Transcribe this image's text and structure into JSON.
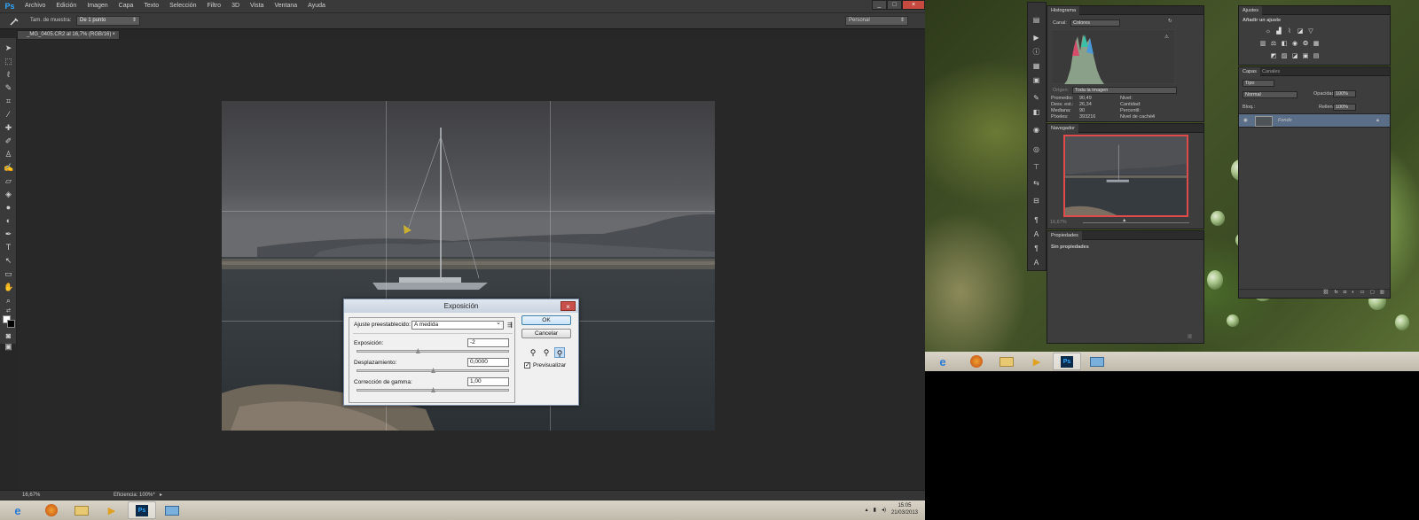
{
  "photoshop": {
    "logo": "Ps",
    "menu": [
      "Archivo",
      "Edición",
      "Imagen",
      "Capa",
      "Texto",
      "Selección",
      "Filtro",
      "3D",
      "Vista",
      "Ventana",
      "Ayuda"
    ],
    "window_buttons": [
      "_",
      "□",
      "×"
    ],
    "options_bar": {
      "sample_size_label": "Tam. de muestra:",
      "sample_size_value": "De 1 punto",
      "workspace_value": "Personal"
    },
    "document_tab": {
      "title": "_MG_0405.CR2 al 16,7% (RGB/16)",
      "close": "×"
    },
    "status_bar": {
      "zoom": "16,67%",
      "info": "Eficiencia: 100%*",
      "arrow": "▸"
    }
  },
  "exposure_dialog": {
    "title": "Exposición",
    "close": "×",
    "preset_label": "Ajuste preestablecido:",
    "preset_value": "A medida",
    "exposure_label": "Exposición:",
    "exposure_value": "-2",
    "exposure_slider_fraction": 0.4,
    "offset_label": "Desplazamiento:",
    "offset_value": "0,0000",
    "offset_slider_fraction": 0.5,
    "gamma_label": "Corrección de gamma:",
    "gamma_value": "1,00",
    "gamma_slider_fraction": 0.5,
    "ok_label": "OK",
    "cancel_label": "Cancelar",
    "preview_label": "Previsualizar",
    "preview_checked": true
  },
  "histogram_panel": {
    "tab": "Histograma",
    "channel_label": "Canal:",
    "channel_value": "Colores",
    "origin_label": "Origen:",
    "origin_value": "Toda la imagen",
    "stats_left": [
      {
        "label": "Promedio:",
        "value": "90,49"
      },
      {
        "label": "Desv. est.:",
        "value": "26,34"
      },
      {
        "label": "Mediana:",
        "value": "90"
      },
      {
        "label": "Píxeles:",
        "value": "393216"
      }
    ],
    "stats_right": [
      {
        "label": "Nivel:",
        "value": ""
      },
      {
        "label": "Cantidad:",
        "value": ""
      },
      {
        "label": "Percentil:",
        "value": ""
      },
      {
        "label": "Nivel de caché:",
        "value": "4"
      }
    ]
  },
  "navigator_panel": {
    "tab": "Navegador",
    "zoom": "16,67%"
  },
  "properties_panel": {
    "tab": "Propiedades",
    "message": "Sin propiedades"
  },
  "adjustments_panel": {
    "tab": "Ajustes",
    "heading": "Añadir un ajuste"
  },
  "layers_panel": {
    "tabs": [
      "Capas",
      "Canales"
    ],
    "filter_value": "Tipo",
    "blend_mode": "Normal",
    "opacity_label": "Opacidad:",
    "opacity_value": "100%",
    "lock_label": "Bloq.:",
    "fill_label": "Relleno:",
    "fill_value": "100%",
    "layer_name": "Fondo"
  },
  "taskbar": {
    "clock_time": "15:05",
    "clock_date": "21/03/2013",
    "ps_label": "Ps"
  },
  "colors": {
    "ps_accent": "#31a8ff",
    "close_red": "#c64a40",
    "navigator_frame": "#e04a4a"
  }
}
